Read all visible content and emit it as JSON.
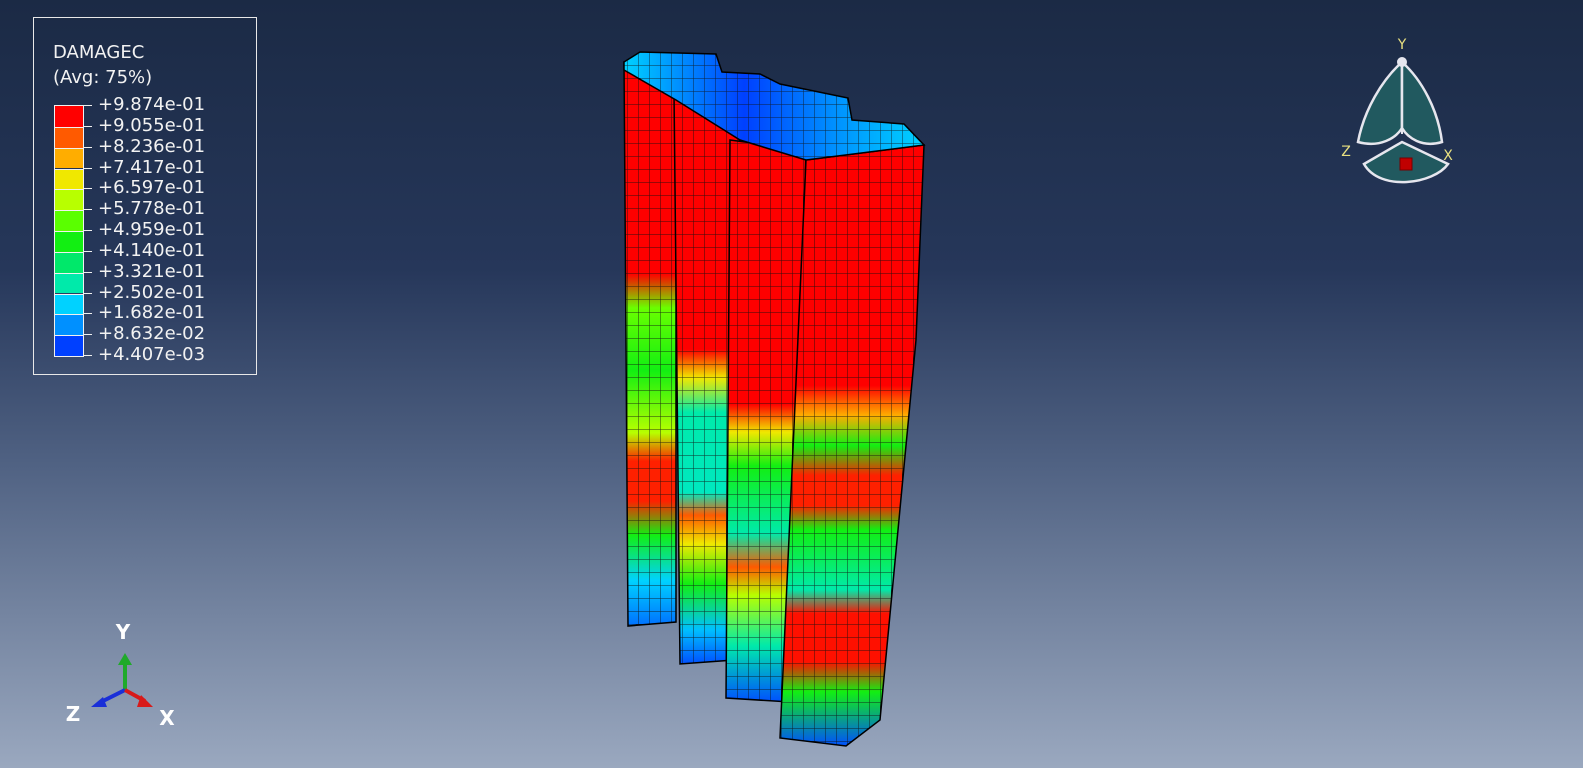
{
  "legend": {
    "variable": "DAMAGEC",
    "averaging": "(Avg: 75%)",
    "values": [
      "+9.874e-01",
      "+9.055e-01",
      "+8.236e-01",
      "+7.417e-01",
      "+6.597e-01",
      "+5.778e-01",
      "+4.959e-01",
      "+4.140e-01",
      "+3.321e-01",
      "+2.502e-01",
      "+1.682e-01",
      "+8.632e-02",
      "+4.407e-03"
    ],
    "colors": [
      "#ff0000",
      "#ff5a00",
      "#ffad00",
      "#f0e800",
      "#b8ff00",
      "#5aff00",
      "#12ef12",
      "#00e86a",
      "#00eaaa",
      "#00d2ff",
      "#0090ff",
      "#0040ff",
      "#0000f0"
    ]
  },
  "view_cube": {
    "y_label": "Y",
    "z_label": "Z",
    "x_label": "X"
  },
  "triad": {
    "y_label": "Y",
    "z_label": "Z",
    "x_label": "X"
  },
  "colors": {
    "background_top": "#1b2a45",
    "background_bottom": "#9aa8bf",
    "mesh_line": "#111111",
    "view_cube_fill": "#21595f",
    "view_cube_label": "#e8e080"
  }
}
